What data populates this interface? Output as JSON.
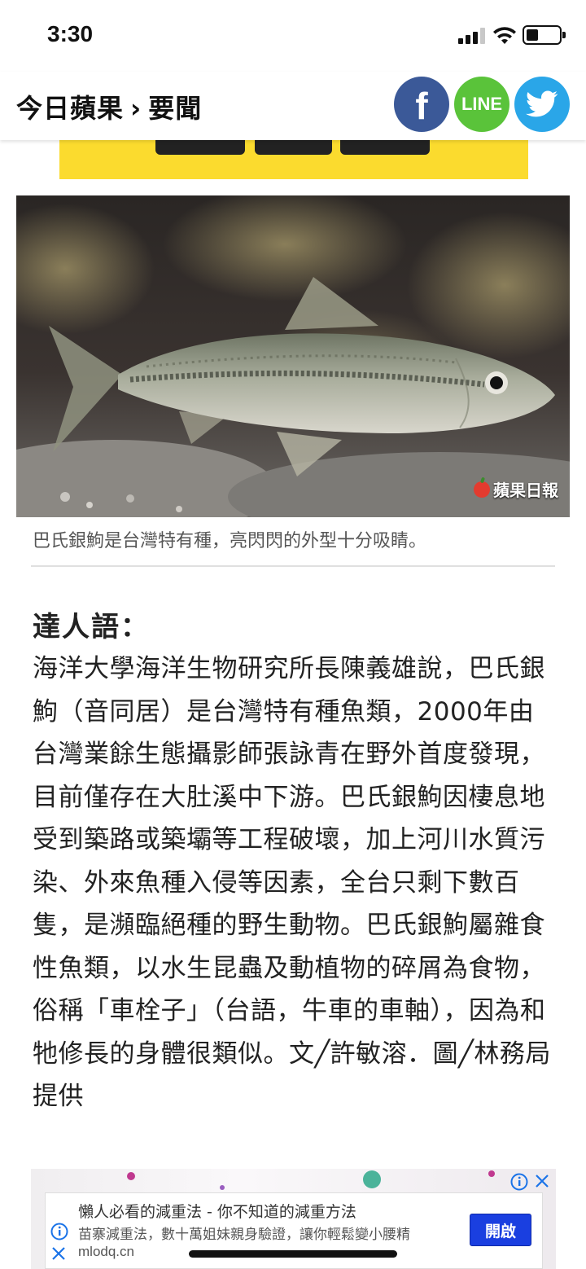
{
  "status_bar": {
    "time": "3:30"
  },
  "header": {
    "breadcrumb_home": "今日蘋果",
    "breadcrumb_separator": "›",
    "breadcrumb_section": "要聞",
    "share": {
      "facebook_label": "f",
      "line_label": "LINE"
    }
  },
  "photo": {
    "watermark": "蘋果日報",
    "caption": "巴氏銀鮈是台灣特有種，亮閃閃的外型十分吸睛。"
  },
  "article": {
    "section_title": "達人語：",
    "body": "海洋大學海洋生物研究所長陳義雄說，巴氏銀鮈（音同居）是台灣特有種魚類，2000年由台灣業餘生態攝影師張詠青在野外首度發現，目前僅存在大肚溪中下游。巴氏銀鮈因棲息地受到築路或築壩等工程破壞，加上河川水質污染、外來魚種入侵等因素，全台只剩下數百隻，是瀕臨絕種的野生動物。巴氏銀鮈屬雜食性魚類，以水生昆蟲及動植物的碎屑為食物，俗稱「車栓子」（台語，牛車的車軸），因為和牠修長的身體很類似。文╱許敏溶．圖╱林務局提供"
  },
  "ad": {
    "title": "懶人必看的減重法 - 你不知道的減重方法",
    "description": "苗寨減重法，數十萬姐妹親身驗證，讓你輕鬆變小腰精",
    "domain": "mlodq.cn",
    "open_button": "開啟"
  },
  "colors": {
    "facebook": "#3b5998",
    "line": "#5ac33a",
    "twitter": "#2aa6e8",
    "banner": "#fbdb2e",
    "ad_button": "#1a3fe0"
  }
}
